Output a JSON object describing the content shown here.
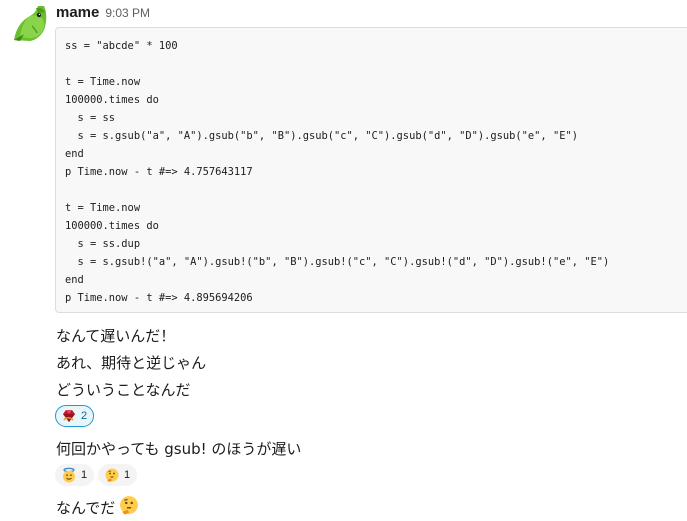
{
  "message": {
    "author": "mame",
    "timestamp": "9:03 PM",
    "avatar_icon": "green-parrot-avatar"
  },
  "code_lines": [
    "ss = \"abcde\" * 100",
    "",
    "t = Time.now",
    "100000.times do",
    "  s = ss",
    "  s = s.gsub(\"a\", \"A\").gsub(\"b\", \"B\").gsub(\"c\", \"C\").gsub(\"d\", \"D\").gsub(\"e\", \"E\")",
    "end",
    "p Time.now - t #=> 4.757643117",
    "",
    "t = Time.now",
    "100000.times do",
    "  s = ss.dup",
    "  s = s.gsub!(\"a\", \"A\").gsub!(\"b\", \"B\").gsub!(\"c\", \"C\").gsub!(\"d\", \"D\").gsub!(\"e\", \"E\")",
    "end",
    "p Time.now - t #=> 4.895694206"
  ],
  "lines": {
    "l1": "なんて遅いんだ！",
    "l2": "あれ、期待と逆じゃん",
    "l3": "どういうことなんだ",
    "l4": "何回かやっても gsub! のほうが遅い",
    "l5": "なんでだ"
  },
  "reactions_1": [
    {
      "icon": "ruby-gem-emoji",
      "count": "2",
      "active": true
    }
  ],
  "reactions_2": [
    {
      "icon": "innocent-face-emoji",
      "count": "1",
      "active": false
    },
    {
      "icon": "thinking-face-emoji",
      "count": "1",
      "active": false
    }
  ],
  "inline_emoji": "thinking-face-emoji",
  "colors": {
    "accent": "#1d9bd1",
    "active_reaction_bg": "#e8f5fa",
    "code_bg": "#f8f8f8",
    "text": "#1d1c1d",
    "muted": "#616061"
  }
}
